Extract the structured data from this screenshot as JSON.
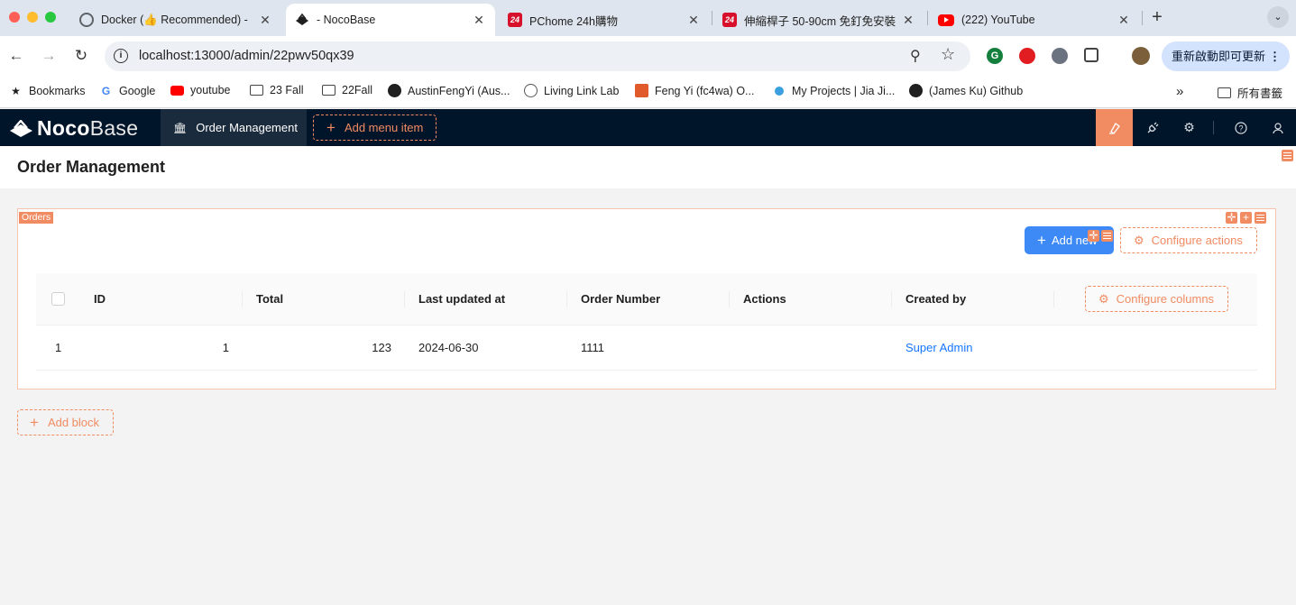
{
  "browser": {
    "tabs": [
      {
        "title": "Docker (👍 Recommended) -",
        "icon": "docker-favicon"
      },
      {
        "title": "- NocoBase",
        "icon": "nocobase-favicon",
        "active": true
      },
      {
        "title": "PChome 24h購物",
        "icon": "pchome-favicon"
      },
      {
        "title": "伸縮桿子 50-90cm 免釘免安裝",
        "icon": "pchome-favicon"
      },
      {
        "title": "(222) YouTube",
        "icon": "youtube-favicon"
      }
    ],
    "url": "localhost:13000/admin/22pwv50qx39",
    "update_button": "重新啟動即可更新",
    "bookmarks": [
      {
        "label": "Bookmarks",
        "icon": "star-icon"
      },
      {
        "label": "Google",
        "icon": "google-icon"
      },
      {
        "label": "youtube",
        "icon": "youtube-icon"
      },
      {
        "label": "23 Fall",
        "icon": "folder-icon"
      },
      {
        "label": "22Fall",
        "icon": "folder-icon"
      },
      {
        "label": "AustinFengYi (Aus...",
        "icon": "github-icon"
      },
      {
        "label": "Living Link Lab",
        "icon": "globe-icon"
      },
      {
        "label": "Feng Yi (fc4wa) O...",
        "icon": "site-icon"
      },
      {
        "label": "My Projects | Jia Ji...",
        "icon": "site-icon"
      },
      {
        "label": "(James Ku) Github",
        "icon": "github-icon"
      }
    ],
    "all_bookmarks": "所有書籤"
  },
  "app": {
    "logo_bold": "Noco",
    "logo_light": "Base",
    "menu_active": "Order Management",
    "add_menu_item": "Add menu item",
    "page_title": "Order Management",
    "block_title": "Orders",
    "add_new_button": "Add new",
    "configure_actions": "Configure actions",
    "configure_columns": "Configure columns",
    "add_block": "Add block",
    "accent_color": "#f18b62",
    "header_color": "#001529",
    "primary_color": "#3d8af7"
  },
  "table": {
    "columns": [
      "ID",
      "Total",
      "Last updated at",
      "Order Number",
      "Actions",
      "Created by"
    ],
    "rows": [
      {
        "index": "1",
        "id": "1",
        "total": "123",
        "updated": "2024-06-30",
        "order_number": "1111",
        "actions": "",
        "created_by": "Super Admin"
      }
    ]
  }
}
